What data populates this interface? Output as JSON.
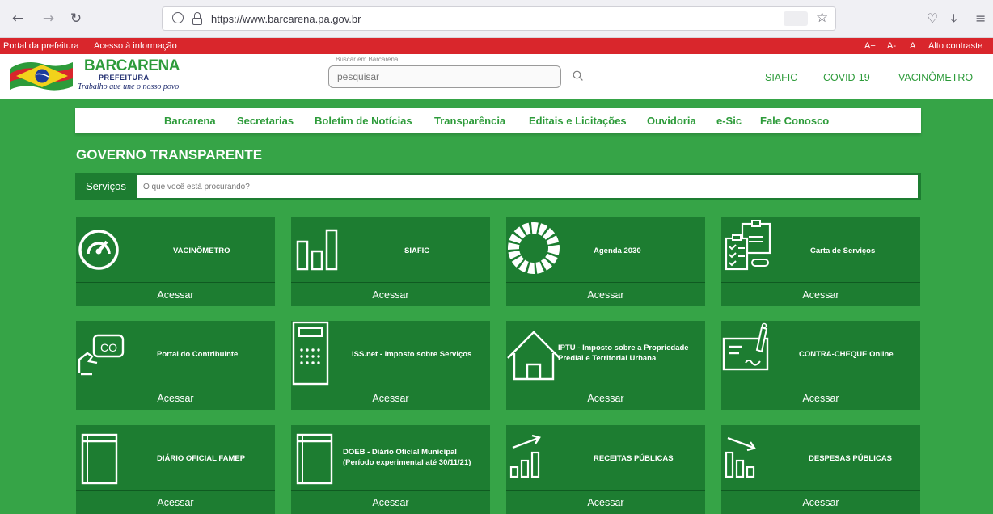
{
  "browser": {
    "url_domain": "https://www.barcarena.pa.gov.br",
    "back_icon": "arrow-left-icon",
    "forward_icon": "arrow-right-icon",
    "reload_icon": "reload-icon"
  },
  "access_bar": {
    "portal": "Portal da prefeitura",
    "info": "Acesso à informação",
    "font_up": "A+",
    "font_down": "A-",
    "font_reset": "A",
    "contrast": "Alto contraste"
  },
  "header": {
    "logo_title": "BARCARENA",
    "logo_sub": "PREFEITURA",
    "logo_slogan": "Trabalho que une o nosso povo",
    "search_label": "Buscar em Barcarena",
    "search_placeholder": "pesquisar",
    "links": [
      "SIAFIC",
      "COVID-19",
      "VACINÔMETRO"
    ]
  },
  "nav": [
    "Barcarena",
    "Secretarias",
    "Boletim de Notícias",
    "Transparência",
    "Editais e Licitações",
    "Ouvidoria",
    "e-Sic",
    "Fale Conosco"
  ],
  "section_title": "GOVERNO TRANSPARENTE",
  "services": {
    "label": "Serviços",
    "placeholder": "O que você está procurando?"
  },
  "cards": [
    {
      "title": "VACINÔMETRO",
      "access": "Acessar",
      "icon": "gauge-icon"
    },
    {
      "title": "SIAFIC",
      "access": "Acessar",
      "icon": "bar-chart-icon"
    },
    {
      "title": "Agenda 2030",
      "access": "Acessar",
      "icon": "sdg-wheel-icon"
    },
    {
      "title": "Carta de Serviços",
      "access": "Acessar",
      "icon": "checklist-clipboard-icon"
    },
    {
      "title": "Portal do Contribuinte",
      "access": "Acessar",
      "icon": "hand-card-icon"
    },
    {
      "title": "ISS.net - Imposto sobre Serviços",
      "access": "Acessar",
      "icon": "calculator-icon"
    },
    {
      "title": "IPTU - Imposto sobre a Propriedade Predial e Territorial Urbana",
      "access": "Acessar",
      "icon": "house-icon"
    },
    {
      "title": "CONTRA-CHEQUE Online",
      "access": "Acessar",
      "icon": "paycheck-icon"
    },
    {
      "title": "DIÁRIO OFICIAL FAMEP",
      "access": "Acessar",
      "icon": "book-icon"
    },
    {
      "title": "DOEB - Diário Oficial Municipal (Período experimental até 30/11/21)",
      "access": "Acessar",
      "icon": "book-icon"
    },
    {
      "title": "RECEITAS PÚBLICAS",
      "access": "Acessar",
      "icon": "chart-up-icon"
    },
    {
      "title": "DESPESAS PÚBLICAS",
      "access": "Acessar",
      "icon": "chart-down-icon"
    }
  ],
  "colors": {
    "green": "#36a447",
    "dark_green": "#1d7d31",
    "red_bar": "#d9262c"
  }
}
